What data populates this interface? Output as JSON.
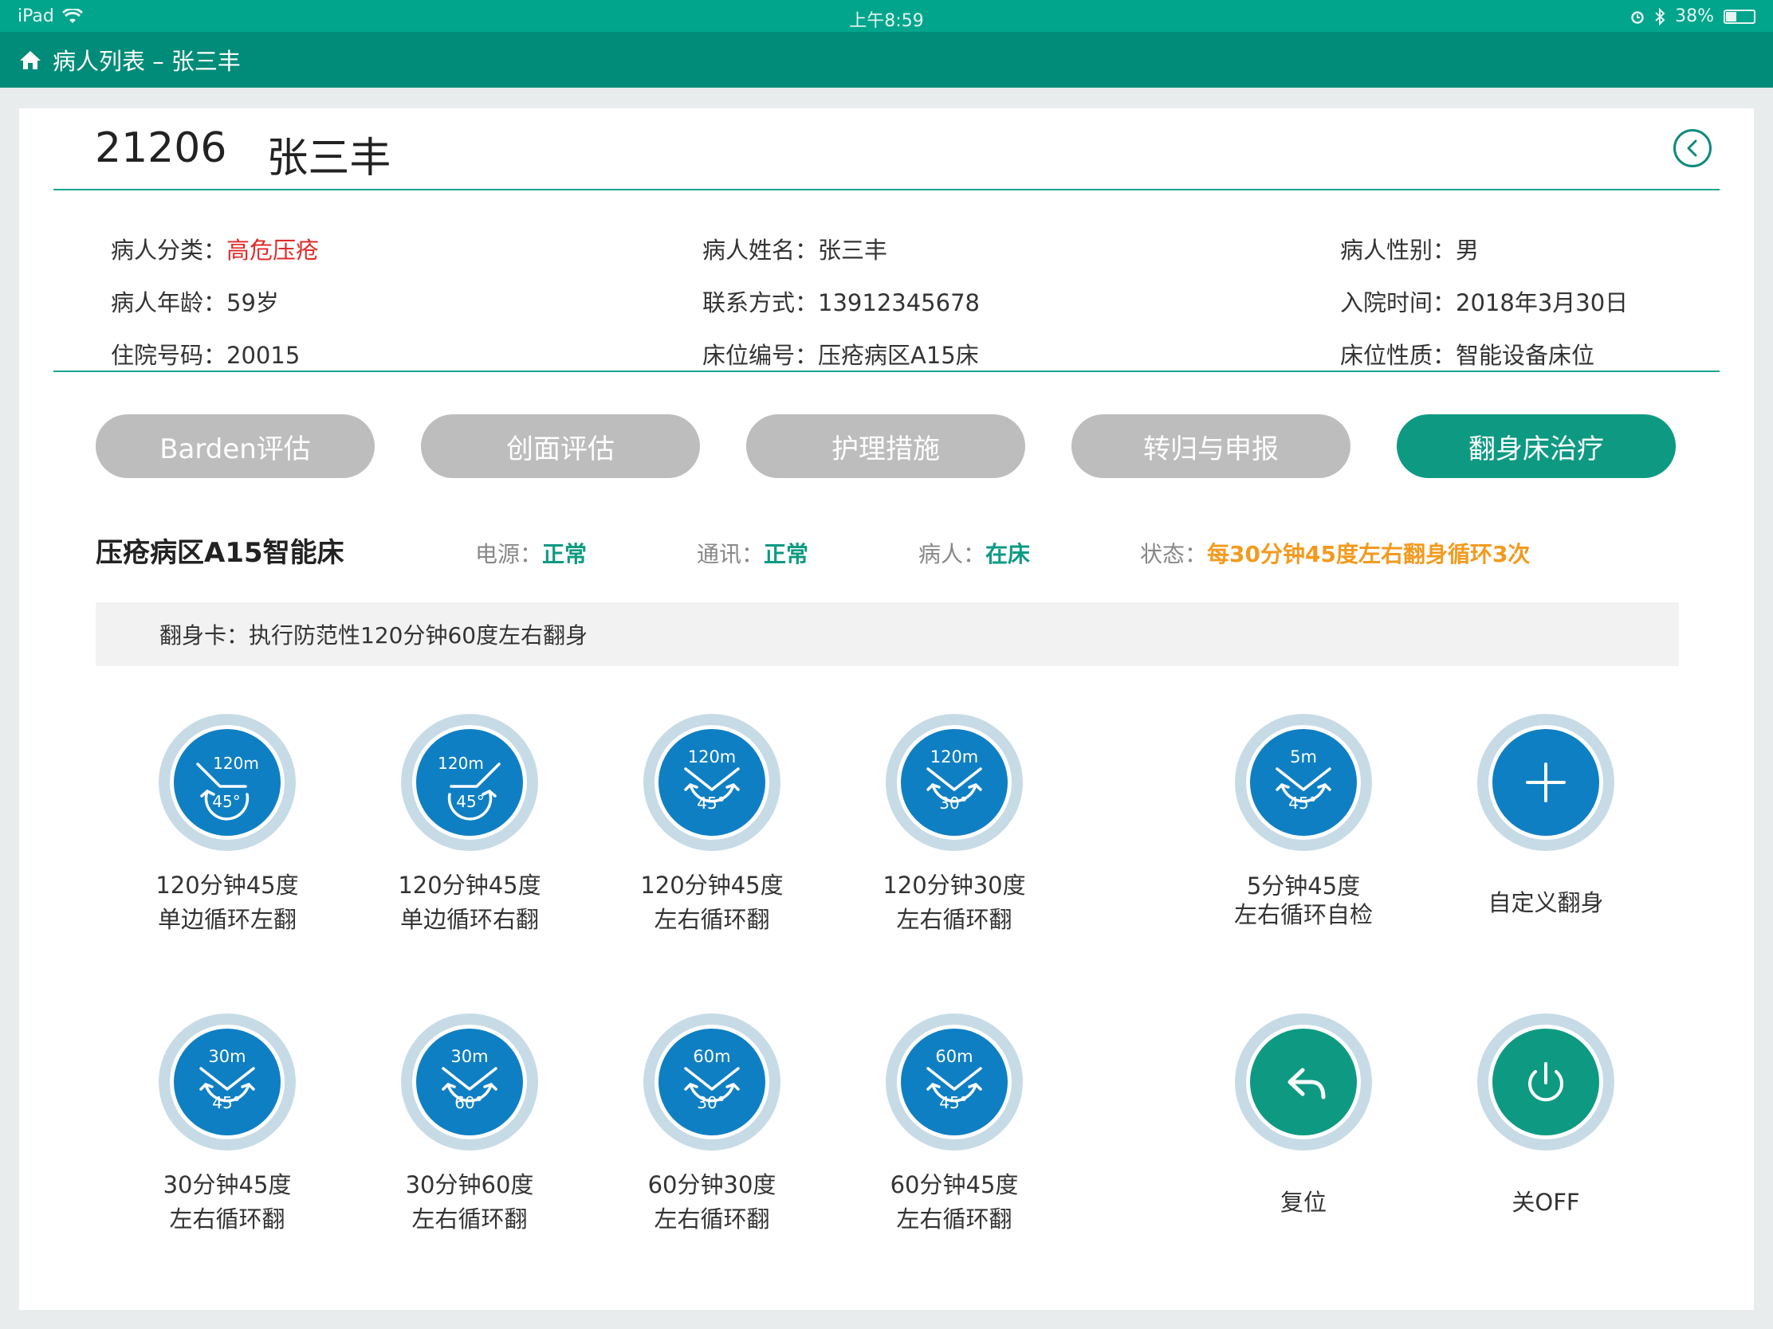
{
  "status_bar": {
    "device": "iPad",
    "time": "上午8:59",
    "battery": "38%",
    "battery_level": 0.38
  },
  "nav": {
    "title": "病人列表 – 张三丰"
  },
  "patient_header": {
    "bed": "21206",
    "name": "张三丰"
  },
  "info": {
    "row1": [
      {
        "label": "病人分类：",
        "value": "高危压疮",
        "highlight": true
      },
      {
        "label": "病人姓名：",
        "value": "张三丰"
      },
      {
        "label": "病人性别：",
        "value": "男"
      }
    ],
    "row2": [
      {
        "label": "病人年龄：",
        "value": "59岁"
      },
      {
        "label": "联系方式：",
        "value": "13912345678"
      },
      {
        "label": "入院时间：",
        "value": "2018年3月30日"
      }
    ],
    "row3": [
      {
        "label": "住院号码：",
        "value": "20015"
      },
      {
        "label": "床位编号：",
        "value": "压疮病区A15床"
      },
      {
        "label": "床位性质：",
        "value": "智能设备床位"
      }
    ]
  },
  "tabs": [
    "Barden评估",
    "创面评估",
    "护理措施",
    "转归与申报",
    "翻身床治疗"
  ],
  "active_tab": "翻身床治疗",
  "device": {
    "name": "压疮病区A15智能床",
    "power_label": "电源：",
    "power": "正常",
    "comm_label": "通讯：",
    "comm": "正常",
    "patient_label": "病人：",
    "patient": "在床",
    "state_label": "状态：",
    "state": "每30分钟45度左右翻身循环3次"
  },
  "turn_card": {
    "label": "翻身卡：",
    "value": "执行防范性120分钟60度左右翻身"
  },
  "programs": [
    {
      "minutes": "120m",
      "angle": "45°",
      "line1": "120分钟45度",
      "line2": "单边循环左翻",
      "mode": "left"
    },
    {
      "minutes": "120m",
      "angle": "45°",
      "line1": "120分钟45度",
      "line2": "单边循环右翻",
      "mode": "right"
    },
    {
      "minutes": "120m",
      "angle": "45°",
      "line1": "120分钟45度",
      "line2": "左右循环翻",
      "mode": "both"
    },
    {
      "minutes": "120m",
      "angle": "30°",
      "line1": "120分钟30度",
      "line2": "左右循环翻",
      "mode": "both"
    },
    {
      "minutes": "5m",
      "angle": "45°",
      "line1": "5分钟45度",
      "line2": "左右循环自检",
      "mode": "both"
    },
    {
      "line1": "自定义翻身",
      "mode": "plus"
    },
    {
      "minutes": "30m",
      "angle": "45°",
      "line1": "30分钟45度",
      "line2": "左右循环翻",
      "mode": "both"
    },
    {
      "minutes": "30m",
      "angle": "60°",
      "line1": "30分钟60度",
      "line2": "左右循环翻",
      "mode": "both"
    },
    {
      "minutes": "60m",
      "angle": "30°",
      "line1": "60分钟30度",
      "line2": "左右循环翻",
      "mode": "both"
    },
    {
      "minutes": "60m",
      "angle": "45°",
      "line1": "60分钟45度",
      "line2": "左右循环翻",
      "mode": "both"
    },
    {
      "line1": "复位",
      "mode": "reset"
    },
    {
      "line1": "关OFF",
      "mode": "power"
    }
  ],
  "colors": {
    "primary": "#0e9a82",
    "statusbar": "#00a58c",
    "navbar": "#008c78",
    "program_blue": "#0f7fc3",
    "warning": "#f39a1e",
    "danger": "#e02a2a"
  }
}
